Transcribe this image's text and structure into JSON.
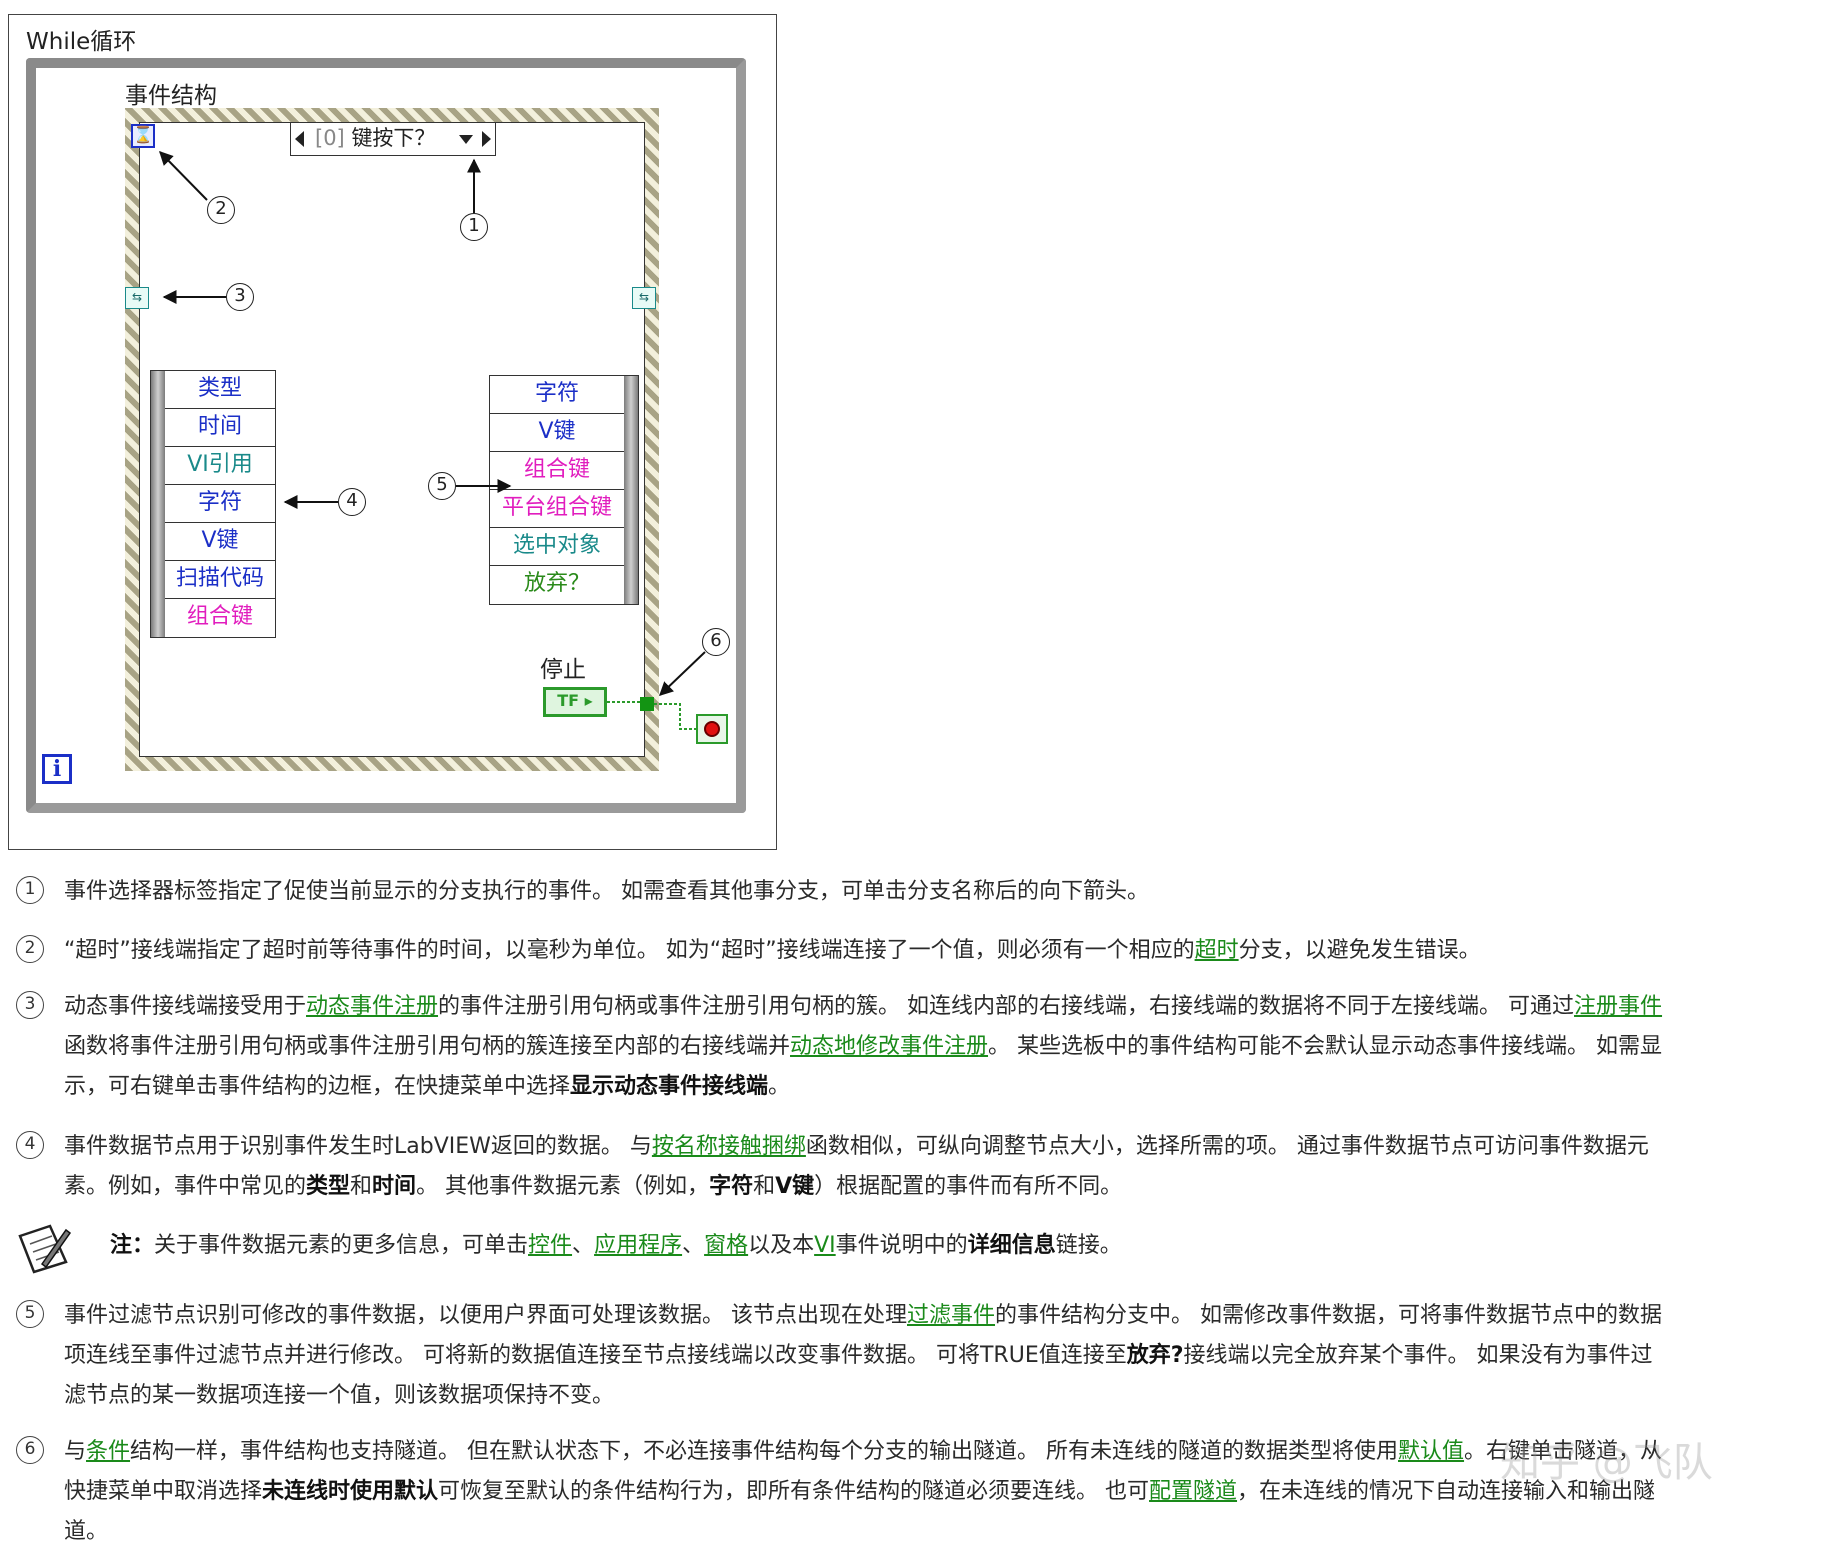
{
  "diagram": {
    "while_label": "While循环",
    "event_label": "事件结构",
    "selector": {
      "index": "[0]",
      "label": "键按下？"
    },
    "iteration_terminal": "i",
    "left_node_items": [
      "类型",
      "时间",
      "VI引用",
      "字符",
      "V键",
      "扫描代码",
      "组合键"
    ],
    "right_node_items": [
      "字符",
      "V键",
      "组合键",
      "平台组合键",
      "选中对象",
      "放弃？"
    ],
    "stop_label": "停止",
    "tf_label": "TF",
    "callouts": [
      "1",
      "2",
      "3",
      "4",
      "5",
      "6"
    ]
  },
  "paragraphs": {
    "p1": {
      "num": "1",
      "l1": "事件选择器标签指定了促使当前显示的分支执行的事件。 如需查看其他事分支，可单击分支名称后的向下箭头。"
    },
    "p2": {
      "num": "2",
      "l1a": "“超时”接线端指定了超时前等待事件的时间，以毫秒为单位。 如为“超时”接线端连接了一个值，则必须有一个相应的",
      "l1link": "超时",
      "l1b": "分支，以避免发生错误。"
    },
    "p3": {
      "num": "3",
      "l1a": "动态事件接线端接受用于",
      "l1link1": "动态事件注册",
      "l1b": "的事件注册引用句柄或事件注册引用句柄的簇。 如连线内部的右接线端，右接线端的数据将不同于左接线端。 可通过",
      "l1link2": "注册事件",
      "l2a": "函数将事件注册引用句柄或事件注册引用句柄的簇连接至内部的右接线端并",
      "l2link": "动态地修改事件注册",
      "l2b": "。 某些选板中的事件结构可能不会默认显示动态事件接线端。 如需显",
      "l3a": "示，可右键单击事件结构的边框，在快捷菜单中选择",
      "l3bold": "显示动态事件接线端",
      "l3b": "。"
    },
    "p4": {
      "num": "4",
      "l1a": "事件数据节点用于识别事件发生时LabVIEW返回的数据。 与",
      "l1link": "按名称接触捆绑",
      "l1b": "函数相似，可纵向调整节点大小，选择所需的项。 通过事件数据节点可访问事件数据元",
      "l2a": "素。例如，事件中常见的",
      "l2bold1": "类型",
      "l2b": "和",
      "l2bold2": "时间",
      "l2c": "。 其他事件数据元素（例如，",
      "l2bold3": "字符",
      "l2d": "和",
      "l2bold4": "V键",
      "l2e": "）根据配置的事件而有所不同。"
    },
    "note": {
      "label": "注：",
      "t1": "关于事件数据元素的更多信息，可单击",
      "link1": "控件",
      "sep1": "、",
      "link2": "应用程序",
      "sep2": "、",
      "link3": "窗格",
      "t2": "以及本",
      "link4": "VI",
      "t3": "事件说明中的",
      "bold": "详细信息",
      "t4": "链接。"
    },
    "p5": {
      "num": "5",
      "l1a": "事件过滤节点识别可修改的事件数据，以便用户界面可处理该数据。 该节点出现在处理",
      "l1link": "过滤事件",
      "l1b": "的事件结构分支中。 如需修改事件数据，可将事件数据节点中的数据",
      "l2a": "项连线至事件过滤节点并进行修改。 可将新的数据值连接至节点接线端以改变事件数据。 可将TRUE值连接至",
      "l2bold": "放弃?",
      "l2b": "接线端以完全放弃某个事件。 如果没有为事件过",
      "l3": "滤节点的某一数据项连接一个值，则该数据项保持不变。"
    },
    "p6": {
      "num": "6",
      "l1a": "与",
      "l1link1": "条件",
      "l1b": "结构一样，事件结构也支持隧道。 但在默认状态下，不必连接事件结构每个分支的输出隧道。 所有未连线的隧道的数据类型将使用",
      "l1link2": "默认值",
      "l1c": "。右键单击隧道，从",
      "l2a": "快捷菜单中取消选择",
      "l2bold": "未连线时使用默认",
      "l2b": "可恢复至默认的条件结构行为，即所有条件结构的隧道必须要连线。 也可",
      "l2link": "配置隧道",
      "l2c": "，在未连线的情况下自动连接输入和输出隧",
      "l3": "道。"
    }
  },
  "watermark": "知乎 @飞队",
  "colors": {
    "link": "#1a8a1a",
    "blue": "#1b2fc7",
    "teal": "#1a8a8a",
    "magenta": "#e11dbe",
    "green": "#2a8a1a"
  }
}
